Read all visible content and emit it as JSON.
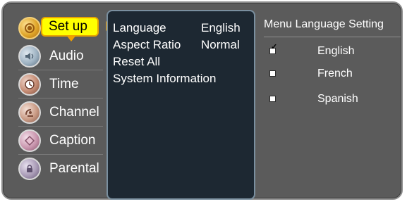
{
  "left_menu": {
    "items": [
      {
        "label": "Set up",
        "icon": "gear-icon",
        "selected": true
      },
      {
        "label": "Audio",
        "icon": "audio-icon",
        "selected": false
      },
      {
        "label": "Time",
        "icon": "clock-icon",
        "selected": false
      },
      {
        "label": "Channel",
        "icon": "satellite-dish-icon",
        "selected": false
      },
      {
        "label": "Caption",
        "icon": "caption-icon",
        "selected": false
      },
      {
        "label": "Parental",
        "icon": "lock-icon",
        "selected": false
      }
    ]
  },
  "settings": {
    "rows": [
      {
        "label": "Language",
        "value": "English"
      },
      {
        "label": "Aspect Ratio",
        "value": "Normal"
      },
      {
        "label": "Reset All",
        "value": ""
      },
      {
        "label": "System Information",
        "value": ""
      }
    ]
  },
  "language_setting": {
    "title": "Menu Language Setting",
    "options": [
      {
        "label": "English",
        "checked": true
      },
      {
        "label": "French",
        "checked": false
      },
      {
        "label": "Spanish",
        "checked": false
      }
    ]
  }
}
